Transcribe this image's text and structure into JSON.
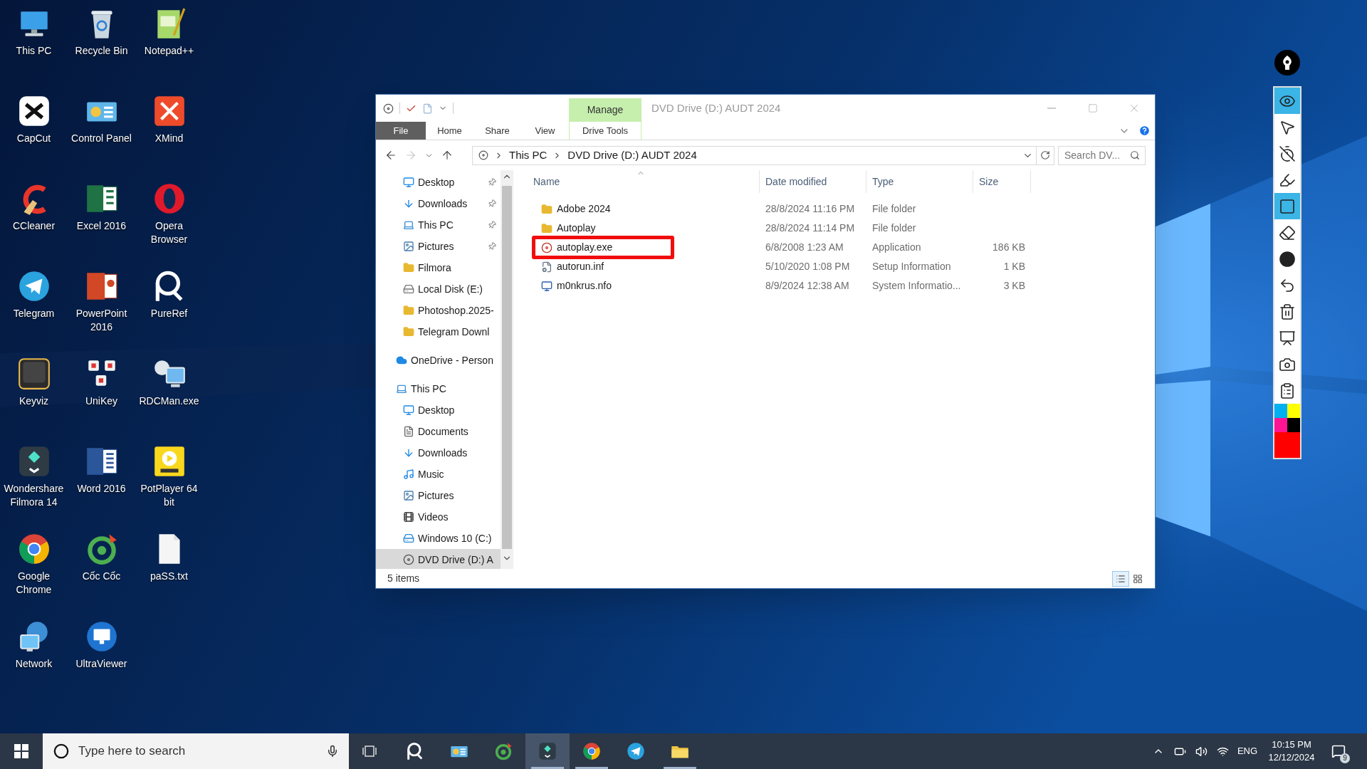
{
  "desktop_icons": [
    {
      "label": "This PC",
      "kind": "pc"
    },
    {
      "label": "Recycle Bin",
      "kind": "bin"
    },
    {
      "label": "Notepad++",
      "kind": "notepad"
    },
    {
      "label": "CapCut",
      "kind": "capcut"
    },
    {
      "label": "Control Panel",
      "kind": "panel"
    },
    {
      "label": "XMind",
      "kind": "xmind"
    },
    {
      "label": "CCleaner",
      "kind": "ccleaner"
    },
    {
      "label": "Excel 2016",
      "kind": "excel"
    },
    {
      "label": "Opera Browser",
      "kind": "opera"
    },
    {
      "label": "Telegram",
      "kind": "telegram"
    },
    {
      "label": "PowerPoint 2016",
      "kind": "powerpoint"
    },
    {
      "label": "PureRef",
      "kind": "pureref"
    },
    {
      "label": "Keyviz",
      "kind": "keyviz"
    },
    {
      "label": "UniKey",
      "kind": "unikey"
    },
    {
      "label": "RDCMan.exe",
      "kind": "rdc"
    },
    {
      "label": "Wondershare Filmora 14",
      "kind": "filmora"
    },
    {
      "label": "Word 2016",
      "kind": "word"
    },
    {
      "label": "PotPlayer 64 bit",
      "kind": "potplayer"
    },
    {
      "label": "Google Chrome",
      "kind": "chrome"
    },
    {
      "label": "Cốc Cốc",
      "kind": "coccoc"
    },
    {
      "label": "paSS.txt",
      "kind": "file"
    },
    {
      "label": "Network",
      "kind": "network"
    },
    {
      "label": "UltraViewer",
      "kind": "ultraviewer"
    }
  ],
  "explorer": {
    "title": "DVD Drive (D:) AUDT 2024",
    "context_tab": "Manage",
    "ribbon_tabs": [
      {
        "label": "File",
        "kind": "file"
      },
      {
        "label": "Home",
        "kind": "plain"
      },
      {
        "label": "Share",
        "kind": "plain"
      },
      {
        "label": "View",
        "kind": "plain"
      },
      {
        "label": "Drive Tools",
        "kind": "context"
      }
    ],
    "nav_buttons": [
      {
        "kind": "back",
        "disabled": false
      },
      {
        "kind": "forward",
        "disabled": true
      },
      {
        "kind": "recent",
        "disabled": false
      },
      {
        "kind": "up",
        "disabled": false
      }
    ],
    "path": [
      "This PC",
      "DVD Drive (D:) AUDT 2024"
    ],
    "search_placeholder": "Search DV...",
    "quick_access": [
      {
        "label": "Desktop",
        "kind": "desktop",
        "pinned": true,
        "selected": false
      },
      {
        "label": "Downloads",
        "kind": "downloads",
        "pinned": true,
        "selected": false
      },
      {
        "label": "This PC",
        "kind": "pc",
        "pinned": true,
        "selected": false
      },
      {
        "label": "Pictures",
        "kind": "pictures",
        "pinned": true,
        "selected": false
      },
      {
        "label": "Filmora",
        "kind": "folder",
        "pinned": false,
        "selected": false
      },
      {
        "label": "Local Disk (E:)",
        "kind": "disk",
        "pinned": false,
        "selected": false
      },
      {
        "label": "Photoshop.2025-",
        "kind": "folder",
        "pinned": false,
        "selected": false
      },
      {
        "label": "Telegram Downl",
        "kind": "folder",
        "pinned": false,
        "selected": false
      }
    ],
    "tree": [
      {
        "label": "OneDrive - Person",
        "kind": "cloud",
        "selected": false
      },
      {
        "label": "This PC",
        "kind": "pc",
        "selected": false,
        "children": [
          {
            "label": "Desktop",
            "kind": "desktop",
            "selected": false
          },
          {
            "label": "Documents",
            "kind": "documents",
            "selected": false
          },
          {
            "label": "Downloads",
            "kind": "downloads",
            "selected": false
          },
          {
            "label": "Music",
            "kind": "music",
            "selected": false
          },
          {
            "label": "Pictures",
            "kind": "pictures",
            "selected": false
          },
          {
            "label": "Videos",
            "kind": "videos",
            "selected": false
          },
          {
            "label": "Windows 10 (C:)",
            "kind": "windows",
            "selected": false
          },
          {
            "label": "DVD Drive (D:) A",
            "kind": "dvd",
            "selected": true
          }
        ]
      }
    ],
    "columns": [
      {
        "label": "Name",
        "sorted": true
      },
      {
        "label": "Date modified",
        "sorted": false
      },
      {
        "label": "Type",
        "sorted": false
      },
      {
        "label": "Size",
        "sorted": false
      }
    ],
    "files": [
      {
        "name": "Adobe 2024",
        "date": "28/8/2024 11:16 PM",
        "type": "File folder",
        "kind": "folder",
        "annotated": false
      },
      {
        "name": "Autoplay",
        "date": "28/8/2024 11:14 PM",
        "type": "File folder",
        "kind": "folder",
        "annotated": false
      },
      {
        "name": "autoplay.exe",
        "date": "6/8/2008 1:23 AM",
        "type": "Application",
        "size": "186 KB",
        "kind": "app",
        "annotated": true
      },
      {
        "name": "autorun.inf",
        "date": "5/10/2020 1:08 PM",
        "type": "Setup Information",
        "size": "1 KB",
        "kind": "setup",
        "annotated": false
      },
      {
        "name": "m0nkrus.nfo",
        "date": "8/9/2024 12:38 AM",
        "type": "System Informatio...",
        "size": "3 KB",
        "kind": "sysinfo",
        "annotated": false
      }
    ],
    "status": "5 items",
    "views": [
      {
        "kind": "details",
        "selected": true
      },
      {
        "kind": "tiles",
        "selected": false
      }
    ]
  },
  "pen_toolbar": {
    "tools": [
      {
        "kind": "eye",
        "selected": true
      },
      {
        "kind": "pointer",
        "selected": false
      },
      {
        "kind": "timer",
        "selected": false
      },
      {
        "kind": "highlighter",
        "selected": false
      },
      {
        "kind": "rectangle",
        "selected": true
      },
      {
        "kind": "eraser",
        "selected": false
      },
      {
        "kind": "dot",
        "selected": false
      },
      {
        "kind": "undo",
        "selected": false
      },
      {
        "kind": "trash",
        "selected": false
      },
      {
        "kind": "easel",
        "selected": false
      },
      {
        "kind": "camera",
        "selected": false
      },
      {
        "kind": "clipboard",
        "selected": false
      }
    ],
    "palette": [
      {
        "color": "#00b0f0"
      },
      {
        "color": "#ffff00"
      },
      {
        "color": "#ff1493"
      },
      {
        "color": "#000000"
      }
    ],
    "current": {
      "color": "#ff0000"
    }
  },
  "taskbar": {
    "search_placeholder": "Type here to search",
    "apps": [
      {
        "kind": "pureref",
        "open": false,
        "selected": false
      },
      {
        "kind": "panel",
        "open": false,
        "selected": false
      },
      {
        "kind": "coccoc",
        "open": false,
        "selected": false
      },
      {
        "kind": "filmora",
        "open": true,
        "selected": true
      },
      {
        "kind": "chrome",
        "open": true,
        "selected": false
      },
      {
        "kind": "telegram",
        "open": false,
        "selected": false
      },
      {
        "kind": "explorer",
        "open": true,
        "selected": false
      }
    ],
    "language": "ENG",
    "time": "10:15 PM",
    "date": "12/12/2024",
    "notifications": "9"
  }
}
